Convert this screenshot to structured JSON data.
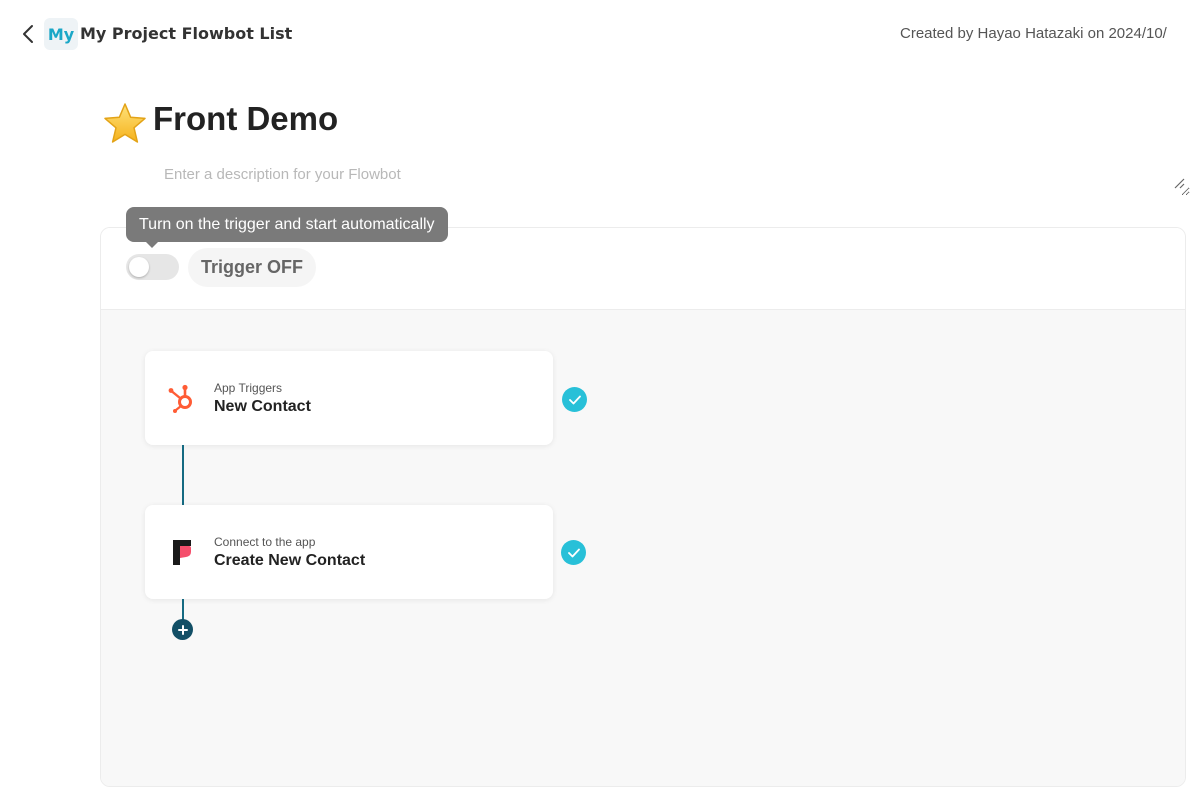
{
  "header": {
    "back_icon": "chevron-left-icon",
    "badge_label": "My",
    "breadcrumb_label": "My Project Flowbot List",
    "created_by": "Created by Hayao Hatazaki on 2024/10/"
  },
  "flowbot": {
    "title_icon": "star-icon",
    "title": "Front Demo",
    "description_value": "",
    "description_placeholder": "Enter a description for your Flowbot"
  },
  "trigger": {
    "enabled": false,
    "label": "Trigger OFF",
    "tooltip": "Turn on the trigger and start automatically"
  },
  "steps": [
    {
      "kicker": "App Triggers",
      "name": "New Contact",
      "icon": "hubspot-icon",
      "status_icon": "check-circle-icon",
      "icon_color": "#ff5c35"
    },
    {
      "kicker": "Connect to the app",
      "name": "Create New Contact",
      "icon": "front-app-icon",
      "status_icon": "check-circle-icon",
      "icon_color": "#f54e6b"
    }
  ],
  "add_step_icon": "plus-circle-icon",
  "colors": {
    "accent": "#1aa7c7",
    "check": "#28c0d8",
    "connector": "#156a82",
    "add_button": "#124f66"
  }
}
